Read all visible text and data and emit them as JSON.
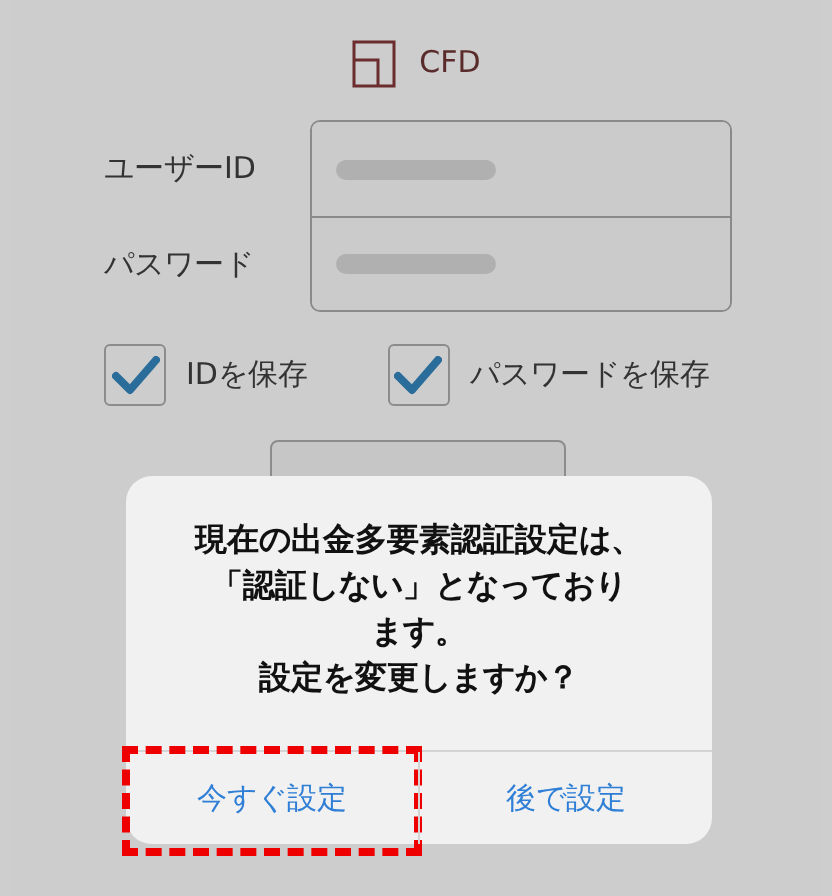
{
  "logo": {
    "text": "CFD"
  },
  "fields": [
    {
      "label": "ユーザーID"
    },
    {
      "label": "パスワード"
    }
  ],
  "checkboxes": [
    {
      "label": "IDを保存",
      "checked": true
    },
    {
      "label": "パスワードを保存",
      "checked": true
    }
  ],
  "dialog": {
    "message": [
      "現在の出金多要素認証設定は、",
      "「認証しない」となっており",
      "ます。",
      "設定を変更しますか？"
    ],
    "buttons": [
      {
        "label": "今すぐ設定",
        "highlighted": true
      },
      {
        "label": "後で設定",
        "highlighted": false
      }
    ]
  }
}
